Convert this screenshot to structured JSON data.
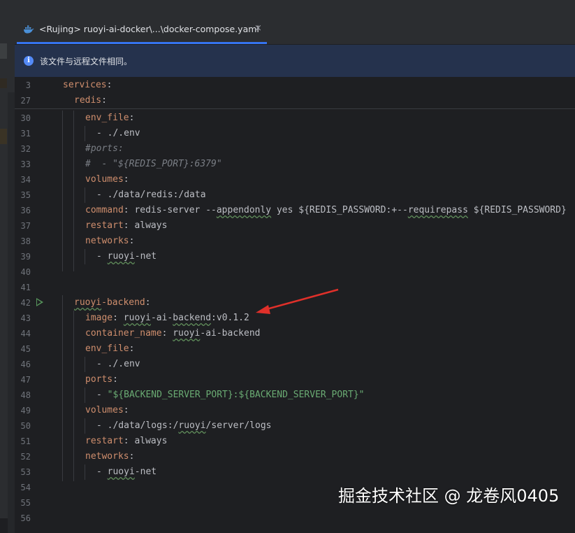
{
  "tab": {
    "icon": "docker-icon",
    "title": "<Rujing> ruoyi-ai-docker\\...\\docker-compose.yaml",
    "close": "×"
  },
  "banner": {
    "icon": "info-icon",
    "message": "该文件与远程文件相同。"
  },
  "lines": [
    {
      "n": "3",
      "indent": 1,
      "parts": [
        {
          "t": "services",
          "c": "k"
        },
        {
          "t": ":",
          "c": "v"
        }
      ]
    },
    {
      "n": "27",
      "indent": 2,
      "parts": [
        {
          "t": "redis",
          "c": "k"
        },
        {
          "t": ":",
          "c": "v"
        }
      ]
    },
    {
      "n": "30",
      "indent": 3,
      "parts": [
        {
          "t": "env_file",
          "c": "k"
        },
        {
          "t": ":",
          "c": "v"
        }
      ]
    },
    {
      "n": "31",
      "indent": 4,
      "parts": [
        {
          "t": "- ./.env",
          "c": "v"
        }
      ]
    },
    {
      "n": "32",
      "indent": 3,
      "parts": [
        {
          "t": "#ports:",
          "c": "c"
        }
      ]
    },
    {
      "n": "33",
      "indent": 3,
      "parts": [
        {
          "t": "#  - \"${REDIS_PORT}:6379\"",
          "c": "c"
        }
      ]
    },
    {
      "n": "34",
      "indent": 3,
      "parts": [
        {
          "t": "volumes",
          "c": "k"
        },
        {
          "t": ":",
          "c": "v"
        }
      ]
    },
    {
      "n": "35",
      "indent": 4,
      "parts": [
        {
          "t": "- ./data/redis:/data",
          "c": "v"
        }
      ]
    },
    {
      "n": "36",
      "indent": 3,
      "parts": [
        {
          "t": "command",
          "c": "k"
        },
        {
          "t": ": redis-server --",
          "c": "v"
        },
        {
          "t": "appendonly",
          "c": "v",
          "w": true
        },
        {
          "t": " yes ${REDIS_PASSWORD:+--",
          "c": "v"
        },
        {
          "t": "requirepass",
          "c": "v",
          "w": true
        },
        {
          "t": " ${REDIS_PASSWORD}",
          "c": "v"
        }
      ]
    },
    {
      "n": "37",
      "indent": 3,
      "parts": [
        {
          "t": "restart",
          "c": "k"
        },
        {
          "t": ": always",
          "c": "v"
        }
      ]
    },
    {
      "n": "38",
      "indent": 3,
      "parts": [
        {
          "t": "networks",
          "c": "k"
        },
        {
          "t": ":",
          "c": "v"
        }
      ]
    },
    {
      "n": "39",
      "indent": 4,
      "parts": [
        {
          "t": "- ",
          "c": "v"
        },
        {
          "t": "ruoyi",
          "c": "v",
          "w": true
        },
        {
          "t": "-net",
          "c": "v"
        }
      ]
    },
    {
      "n": "40",
      "indent": 0,
      "parts": []
    },
    {
      "n": "41",
      "indent": 0,
      "parts": []
    },
    {
      "n": "42",
      "indent": 2,
      "run": true,
      "parts": [
        {
          "t": "ruoyi",
          "c": "k",
          "w": true
        },
        {
          "t": "-backend",
          "c": "k"
        },
        {
          "t": ":",
          "c": "v"
        }
      ]
    },
    {
      "n": "43",
      "indent": 3,
      "parts": [
        {
          "t": "image",
          "c": "k"
        },
        {
          "t": ": ",
          "c": "v"
        },
        {
          "t": "ruoyi",
          "c": "v",
          "w": true
        },
        {
          "t": "-ai-",
          "c": "v"
        },
        {
          "t": "backend",
          "c": "v",
          "w": true
        },
        {
          "t": ":v0.1.2",
          "c": "v"
        }
      ]
    },
    {
      "n": "44",
      "indent": 3,
      "parts": [
        {
          "t": "container_name",
          "c": "k"
        },
        {
          "t": ": ",
          "c": "v"
        },
        {
          "t": "ruoyi",
          "c": "v",
          "w": true
        },
        {
          "t": "-ai-backend",
          "c": "v"
        }
      ]
    },
    {
      "n": "45",
      "indent": 3,
      "parts": [
        {
          "t": "env_file",
          "c": "k"
        },
        {
          "t": ":",
          "c": "v"
        }
      ]
    },
    {
      "n": "46",
      "indent": 4,
      "parts": [
        {
          "t": "- ./.env",
          "c": "v"
        }
      ]
    },
    {
      "n": "47",
      "indent": 3,
      "parts": [
        {
          "t": "ports",
          "c": "k"
        },
        {
          "t": ":",
          "c": "v"
        }
      ]
    },
    {
      "n": "48",
      "indent": 4,
      "parts": [
        {
          "t": "- ",
          "c": "v"
        },
        {
          "t": "\"${BACKEND_SERVER_PORT}:${BACKEND_SERVER_PORT}\"",
          "c": "s"
        }
      ]
    },
    {
      "n": "49",
      "indent": 3,
      "parts": [
        {
          "t": "volumes",
          "c": "k"
        },
        {
          "t": ":",
          "c": "v"
        }
      ]
    },
    {
      "n": "50",
      "indent": 4,
      "parts": [
        {
          "t": "- ./data/logs:/",
          "c": "v"
        },
        {
          "t": "ruoyi",
          "c": "v",
          "w": true
        },
        {
          "t": "/server/logs",
          "c": "v"
        }
      ]
    },
    {
      "n": "51",
      "indent": 3,
      "parts": [
        {
          "t": "restart",
          "c": "k"
        },
        {
          "t": ": always",
          "c": "v"
        }
      ]
    },
    {
      "n": "52",
      "indent": 3,
      "parts": [
        {
          "t": "networks",
          "c": "k"
        },
        {
          "t": ":",
          "c": "v"
        }
      ]
    },
    {
      "n": "53",
      "indent": 4,
      "parts": [
        {
          "t": "- ",
          "c": "v"
        },
        {
          "t": "ruoyi",
          "c": "v",
          "w": true
        },
        {
          "t": "-net",
          "c": "v"
        }
      ]
    },
    {
      "n": "54",
      "indent": 0,
      "parts": []
    },
    {
      "n": "55",
      "indent": 0,
      "parts": []
    },
    {
      "n": "56",
      "indent": 0,
      "parts": []
    }
  ],
  "watermark": "掘金技术社区 @ 龙卷风0405",
  "colors": {
    "keyword": "#cf8e6d",
    "comment": "#7a7e85",
    "string": "#6aab73",
    "text": "#bcbec4",
    "accent": "#3574f0",
    "arrow": "#e0302a"
  }
}
